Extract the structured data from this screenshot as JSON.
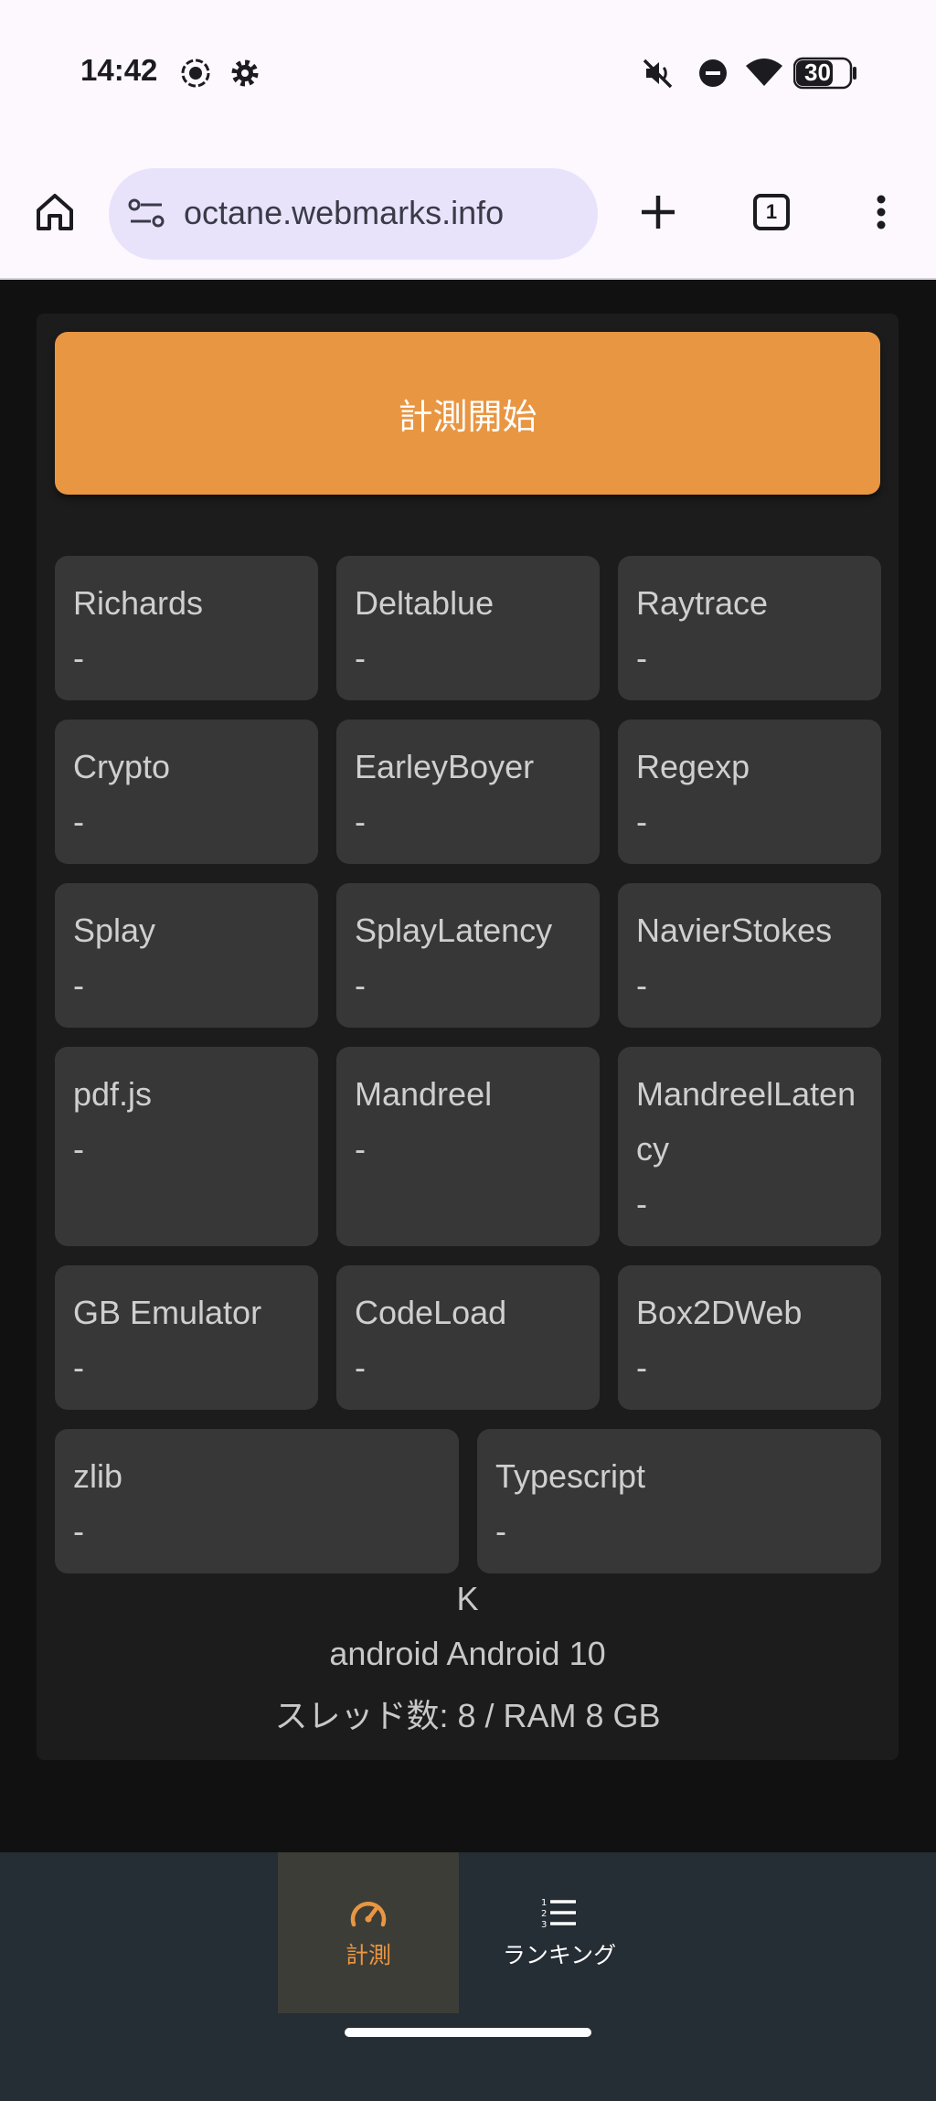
{
  "status_bar": {
    "time": "14:42",
    "battery": "30",
    "icons": [
      "screen-record-icon",
      "settings-icon",
      "mute-icon",
      "dnd-icon",
      "wifi-icon",
      "battery-icon"
    ]
  },
  "browser": {
    "url": "octane.webmarks.info",
    "tab_count": "1"
  },
  "start_button": "計測開始",
  "tests": [
    {
      "name": "Richards",
      "value": "-"
    },
    {
      "name": "Deltablue",
      "value": "-"
    },
    {
      "name": "Raytrace",
      "value": "-"
    },
    {
      "name": "Crypto",
      "value": "-"
    },
    {
      "name": "EarleyBoyer",
      "value": "-"
    },
    {
      "name": "Regexp",
      "value": "-"
    },
    {
      "name": "Splay",
      "value": "-"
    },
    {
      "name": "SplayLatency",
      "value": "-"
    },
    {
      "name": "NavierStokes",
      "value": "-"
    },
    {
      "name": "pdf.js",
      "value": "-"
    },
    {
      "name": "Mandreel",
      "value": "-"
    },
    {
      "name": "MandreelLatency",
      "value": "-"
    },
    {
      "name": "GB Emulator",
      "value": "-"
    },
    {
      "name": "CodeLoad",
      "value": "-"
    },
    {
      "name": "Box2DWeb",
      "value": "-"
    },
    {
      "name": "zlib",
      "value": "-"
    },
    {
      "name": "Typescript",
      "value": "-"
    }
  ],
  "device_info": {
    "line1": "K",
    "line2": "android Android 10",
    "line3": "スレッド数: 8 / RAM 8 GB"
  },
  "bottom_nav": {
    "measure": "計測",
    "ranking": "ランキング"
  },
  "colors": {
    "accent": "#e99642",
    "card": "#373737",
    "panel": "#1c1c1c",
    "nav": "#252d35"
  }
}
